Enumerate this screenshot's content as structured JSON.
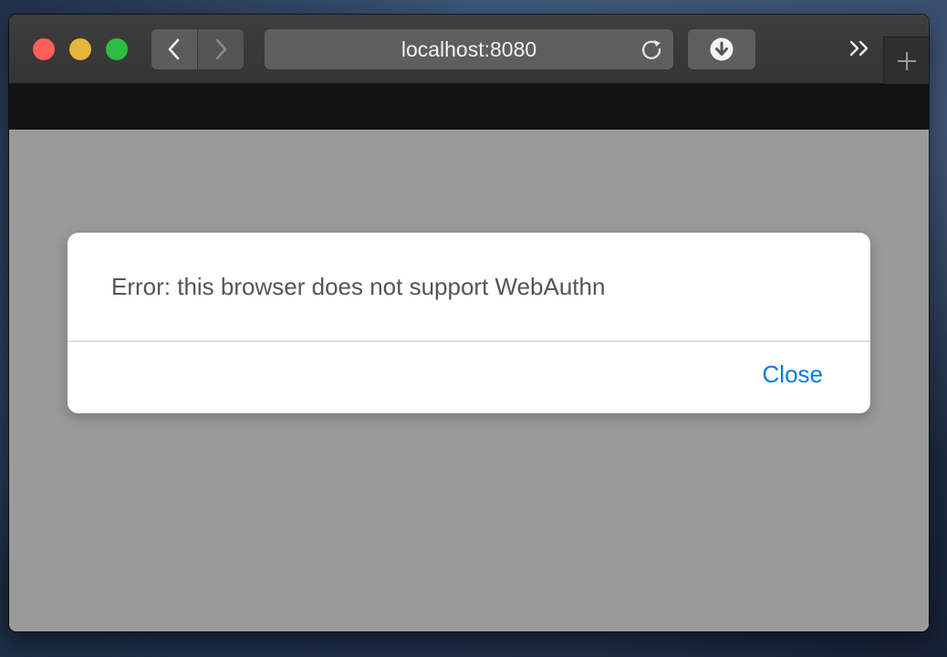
{
  "browser": {
    "address": "localhost:8080"
  },
  "icons": {
    "back": "chevron-left-icon",
    "forward": "chevron-right-icon",
    "reload": "reload-icon",
    "download": "download-icon",
    "overflow": "double-chevron-right-icon",
    "new_tab": "plus-icon"
  },
  "dialog": {
    "message": "Error: this browser does not support WebAuthn",
    "close_label": "Close"
  },
  "colors": {
    "accent": "#0a7ae0",
    "close_dot": "#fe5f57",
    "minimize_dot": "#e8b53a",
    "maximize_dot": "#2fbc45"
  }
}
